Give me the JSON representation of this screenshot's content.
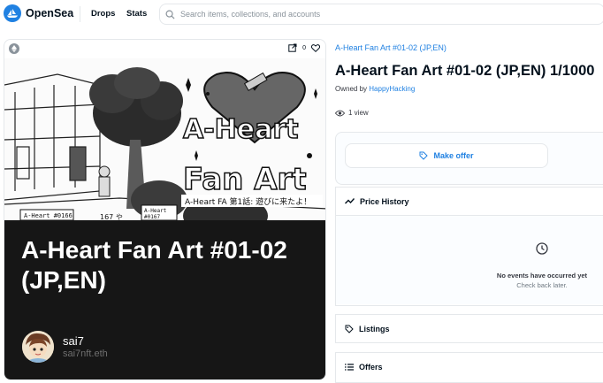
{
  "header": {
    "brand": "OpenSea",
    "nav": [
      "Drops",
      "Stats"
    ],
    "search_placeholder": "Search items, collections, and accounts"
  },
  "media": {
    "likes": "0",
    "artwork_title": "A-Heart Fan Art #01-02 (JP,EN)",
    "creator_name": "sai7",
    "creator_ens": "sai7nft.eth"
  },
  "item": {
    "collection": "A-Heart Fan Art #01-02 (JP,EN)",
    "title": "A-Heart Fan Art #01-02 (JP,EN) 1/1000",
    "owned_by_label": "Owned by",
    "owner": "HappyHacking",
    "views": "1 view",
    "make_offer": "Make offer"
  },
  "price_history": {
    "label": "Price History",
    "empty_title": "No events have occurred yet",
    "empty_sub": "Check back later."
  },
  "listings": {
    "label": "Listings"
  },
  "offers": {
    "label": "Offers"
  },
  "colors": {
    "accent": "#2081e2",
    "border": "#e5e8eb",
    "dark_panel": "#161616"
  }
}
